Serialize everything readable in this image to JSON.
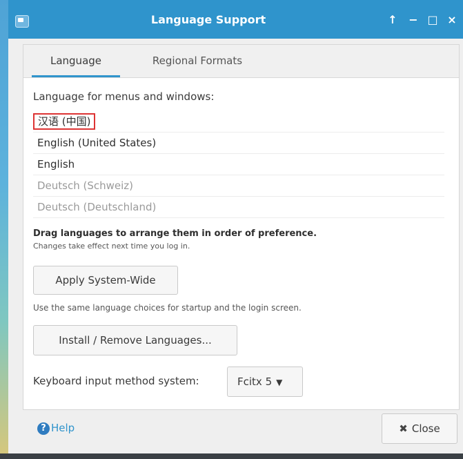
{
  "window": {
    "title": "Language Support",
    "controls": {
      "up": "↑",
      "minimize": "−",
      "maximize": "□",
      "close": "×"
    }
  },
  "tabs": {
    "language": "Language",
    "regional": "Regional Formats"
  },
  "language_tab": {
    "menus_label": "Language for menus and windows:",
    "languages": [
      "汉语 (中国)",
      "English (United States)",
      "English",
      "Deutsch (Schweiz)",
      "Deutsch (Deutschland)"
    ],
    "drag_hint": "Drag languages to arrange them in order of preference.",
    "drag_note": "Changes take effect next time you log in.",
    "apply_button": "Apply System-Wide",
    "apply_note": "Use the same language choices for startup and the login screen.",
    "install_button": "Install / Remove Languages...",
    "keyboard_label": "Keyboard input method system:",
    "keyboard_value": "Fcitx 5"
  },
  "footer": {
    "help": "Help",
    "close": "Close"
  },
  "colors": {
    "titlebar": "#2f94cc",
    "highlight_border": "#dd3333"
  }
}
